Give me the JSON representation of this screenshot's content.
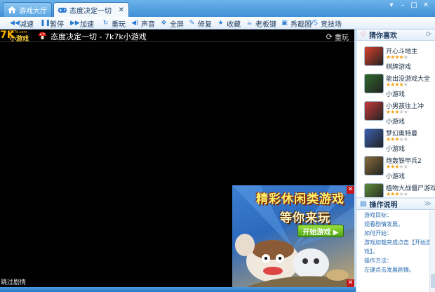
{
  "tabs": [
    {
      "label": "游戏大厅",
      "active": false
    },
    {
      "label": "态度决定一切",
      "active": true
    }
  ],
  "window_controls": {
    "menu": "▾",
    "min": "–",
    "max": "□",
    "close": "✕"
  },
  "toolbar": [
    {
      "label": "减速",
      "icon": "rewind-icon",
      "glyph": "◀◀"
    },
    {
      "label": "暂停",
      "icon": "pause-icon",
      "glyph": "❚❚"
    },
    {
      "label": "加速",
      "icon": "fast-forward-icon",
      "glyph": "▶▶"
    },
    {
      "label": "重玩",
      "icon": "replay-icon",
      "glyph": "↻"
    },
    {
      "label": "声音",
      "icon": "speaker-icon",
      "glyph": "◀)"
    },
    {
      "label": "全屏",
      "icon": "fullscreen-icon",
      "glyph": "✥"
    },
    {
      "label": "修复",
      "icon": "wrench-icon",
      "glyph": "✎"
    },
    {
      "label": "收藏",
      "icon": "star-icon",
      "glyph": "★"
    },
    {
      "label": "老板键",
      "icon": "boss-key-icon",
      "glyph": "☕"
    },
    {
      "label": "秀截图",
      "icon": "screenshot-icon",
      "glyph": "▣"
    },
    {
      "label": "竞技场",
      "icon": "arena-icon",
      "glyph": "VS"
    }
  ],
  "game": {
    "logo_k": "7K",
    "logo_small": "7k7k.com",
    "logo_text": "小游戏",
    "title": "态度决定一切 - 7k7k小游戏",
    "refresh": "重玩",
    "status": "跳过剧情"
  },
  "ad": {
    "headline": "精彩休闲类游戏",
    "subheadline": "等你来玩",
    "button": "开始游戏 ▶",
    "close": "✕"
  },
  "panel": {
    "recommend_title": "猜你喜欢",
    "refresh_glyph": "⟳",
    "games": [
      {
        "name": "开心斗地主",
        "rating": 4,
        "category": "棋牌游戏",
        "color": "#d8402a"
      },
      {
        "name": "能出没游戏大全",
        "rating": 4,
        "category": "小游戏",
        "color": "#2e6a2c"
      },
      {
        "name": "小男孩往上冲",
        "rating": 3,
        "category": "小游戏",
        "color": "#c73a3a"
      },
      {
        "name": "梦幻奥特曼",
        "rating": 3,
        "category": "小游戏",
        "color": "#3c5fb0"
      },
      {
        "name": "炮轰铁甲兵2",
        "rating": 3,
        "category": "小游戏",
        "color": "#8a6d3a"
      },
      {
        "name": "植物大战僵尸游戏",
        "rating": 3,
        "category": "小游戏",
        "color": "#5d8c3b"
      }
    ],
    "guide_title": "操作说明",
    "guide_toggle": "≫",
    "guide_lines": [
      "游戏目标：",
      "观看剧情发展。",
      "如何开始：",
      "游戏加载完成点击【开始游",
      "戏】。",
      "操作方法：",
      "左键点击发展剧情。"
    ]
  }
}
